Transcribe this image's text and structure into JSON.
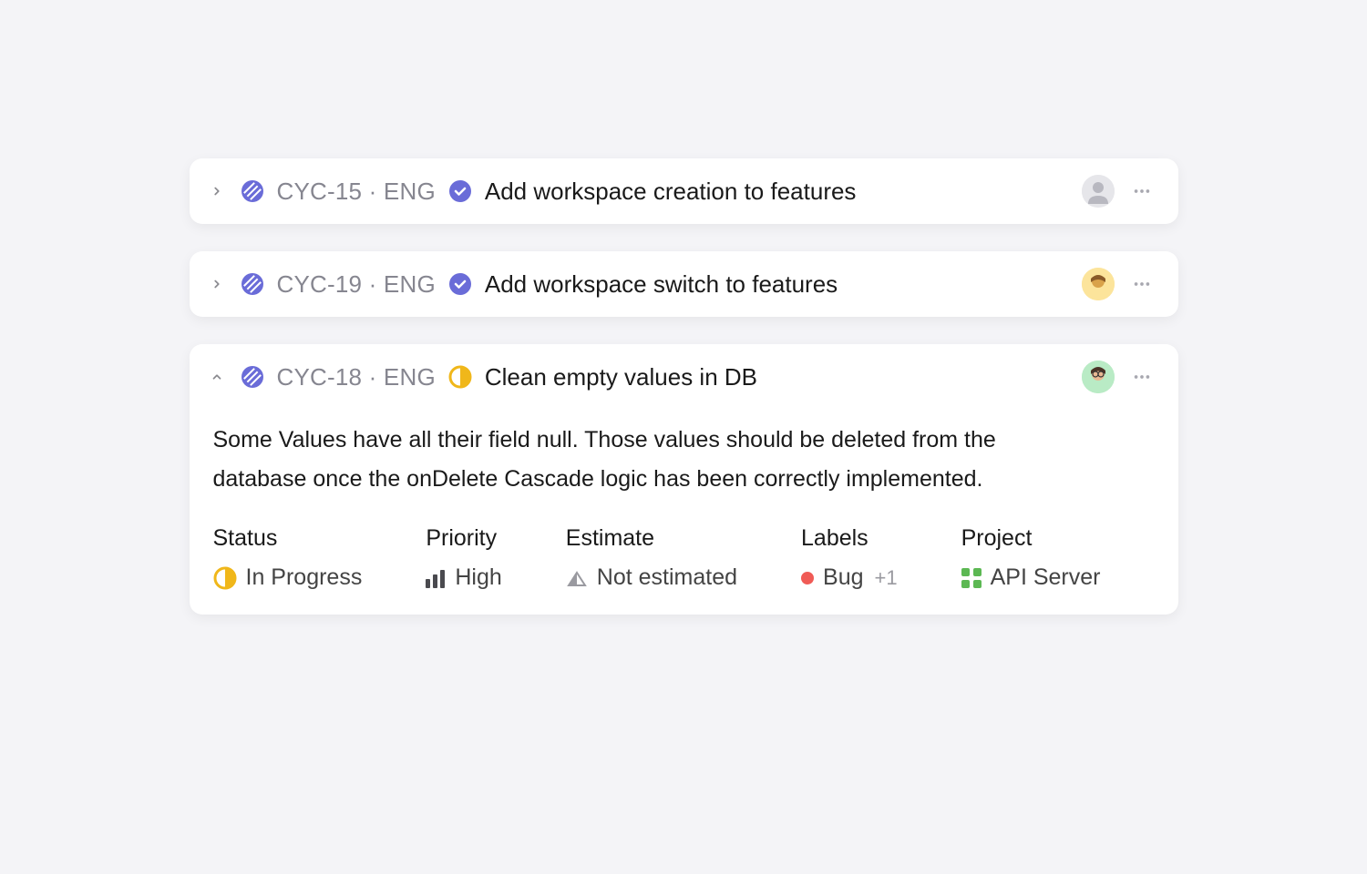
{
  "issues": [
    {
      "id": "CYC-15",
      "team": "ENG",
      "status": "done",
      "title": "Add workspace creation to features",
      "expanded": false,
      "avatar_theme": "grey"
    },
    {
      "id": "CYC-19",
      "team": "ENG",
      "status": "done",
      "title": "Add workspace switch to features",
      "expanded": false,
      "avatar_theme": "yellow"
    },
    {
      "id": "CYC-18",
      "team": "ENG",
      "status": "in_progress",
      "title": "Clean empty values in DB",
      "expanded": true,
      "avatar_theme": "green",
      "description": "Some Values have all their field null. Those values should be deleted from the database once the onDelete Cascade logic has been correctly implemented.",
      "fields": {
        "status": {
          "label": "Status",
          "value": "In Progress"
        },
        "priority": {
          "label": "Priority",
          "value": "High"
        },
        "estimate": {
          "label": "Estimate",
          "value": "Not estimated"
        },
        "labels": {
          "label": "Labels",
          "value": "Bug",
          "extra_count": "+1"
        },
        "project": {
          "label": "Project",
          "value": "API Server"
        }
      }
    }
  ],
  "separator": "·"
}
